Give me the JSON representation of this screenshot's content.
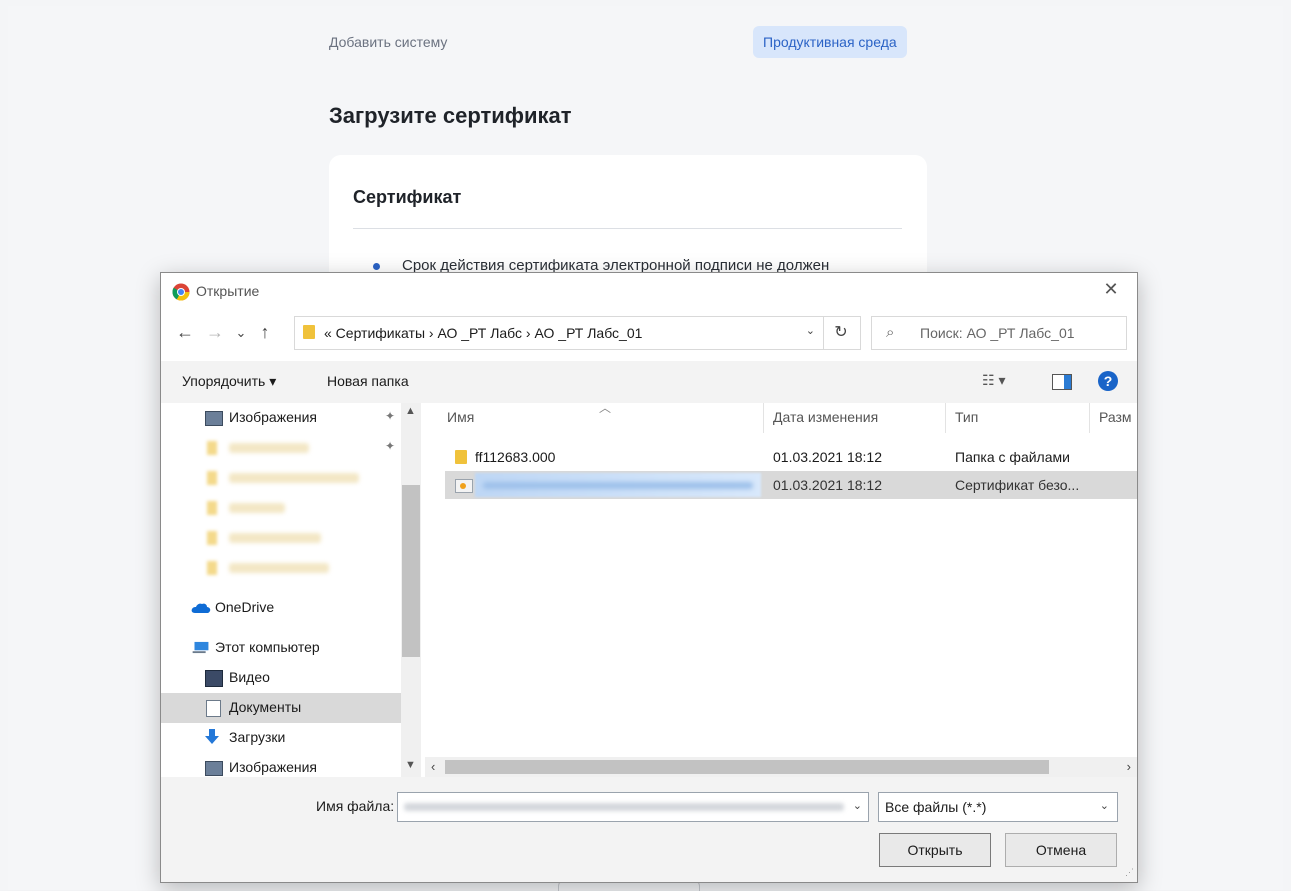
{
  "page": {
    "add_system": "Добавить систему",
    "env_badge": "Продуктивная среда",
    "heading": "Загрузите сертификат",
    "card_title": "Сертификат",
    "card_note": "Срок действия сертификата электронной подписи не должен"
  },
  "dialog": {
    "title": "Открытие",
    "close": "✕",
    "nav": {
      "back": "←",
      "forward": "→",
      "recent": "⌄",
      "up": "↑"
    },
    "address": "« Сертификаты › АО _РТ Лабс › АО _РТ Лабс_01",
    "refresh": "↻",
    "search_placeholder": "Поиск: АО _РТ Лабс_01",
    "toolbar": {
      "organize": "Упорядочить ▾",
      "new_folder": "Новая папка",
      "view": "☷ ▾",
      "help": "?"
    },
    "nav_items": [
      {
        "label": "Изображения"
      },
      {
        "label": "OneDrive"
      },
      {
        "label": "Этот компьютер"
      },
      {
        "label": "Видео"
      },
      {
        "label": "Документы"
      },
      {
        "label": "Загрузки"
      },
      {
        "label": "Изображения"
      }
    ],
    "columns": {
      "name": "Имя",
      "date": "Дата изменения",
      "type": "Тип",
      "size": "Разм"
    },
    "files": [
      {
        "name": "ff112683.000",
        "date": "01.03.2021 18:12",
        "type": "Папка с файлами"
      },
      {
        "name": "",
        "date": "01.03.2021 18:12",
        "type": "Сертификат безо..."
      }
    ],
    "file_name_label": "Имя файла:",
    "file_type": "Все файлы (*.*)",
    "open_button": "Открыть",
    "cancel_button": "Отмена"
  },
  "colors": {
    "accent": "#2b63c6",
    "badge_bg": "#d8e6fb",
    "selection": "#d9d9d9",
    "folder": "#f0c23b"
  }
}
